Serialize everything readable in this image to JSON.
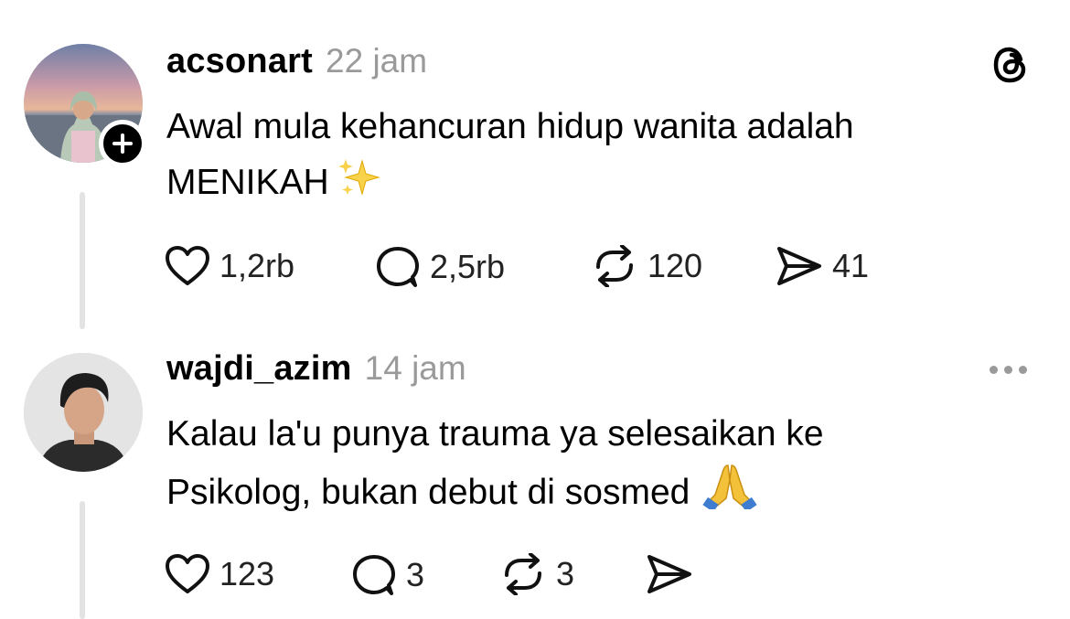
{
  "app": {
    "logo_icon": "threads-logo-icon"
  },
  "posts": [
    {
      "username": "acsonart",
      "time": "22 jam",
      "content_lines": [
        "Awal mula kehancuran hidup wanita adalah",
        "MENIKAH"
      ],
      "emoji": "sparkles-emoji",
      "has_follow_badge": true,
      "actions": {
        "like": "1,2rb",
        "reply": "2,5rb",
        "repost": "120",
        "share": "41"
      }
    },
    {
      "username": "wajdi_azim",
      "time": "14 jam",
      "content_lines": [
        "Kalau la'u punya trauma ya selesaikan ke",
        "Psikolog, bukan debut di sosmed"
      ],
      "emoji": "folded-hands-emoji",
      "actions": {
        "like": "123",
        "reply": "3",
        "repost": "3",
        "share": ""
      }
    }
  ],
  "colors": {
    "muted": "#9a9a9a",
    "thread_line": "#e3e3e3",
    "text": "#000000"
  }
}
